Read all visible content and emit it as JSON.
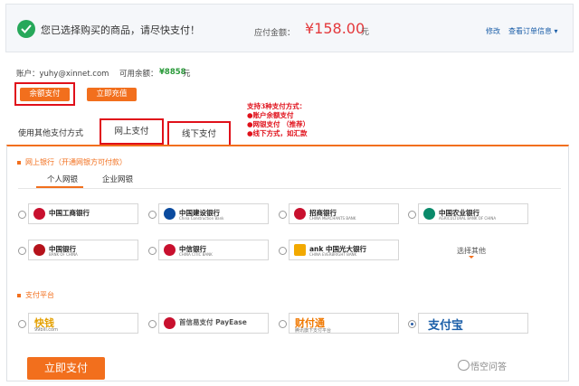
{
  "header": {
    "message": "您已选择购买的商品，请尽快支付！",
    "due_label": "应付金额：",
    "amount": "¥158.00",
    "amount_unit": "元",
    "modify_link": "修改",
    "order_info_link": "查看订单信息 ▾"
  },
  "account": {
    "account_text": "账户：yuhy@xinnet.com",
    "balance_label": "可用余额：",
    "balance_value": "¥8858",
    "balance_unit": "元",
    "balance_pay_button": "余额支付",
    "recharge_button": "立即充值"
  },
  "other_methods": {
    "label": "使用其他支付方式",
    "tab_online": "网上支付",
    "tab_offline": "线下支付"
  },
  "annotation": {
    "lines": [
      "支持3种支付方式：",
      "●账户余额支付",
      "●网银支付  （推荐）",
      "●线下方式，如汇款"
    ]
  },
  "online_bank": {
    "title": "网上银行（开通网银方可付款）",
    "tab_personal": "个人网银",
    "tab_corporate": "企业网银",
    "banks": [
      {
        "name": "中国工商银行",
        "sub": "",
        "color": "#c8102e"
      },
      {
        "name": "中国建设银行",
        "sub": "China Construction Bank",
        "color": "#0a4a9e"
      },
      {
        "name": "招商银行",
        "sub": "CHINA MERCHANTS BANK",
        "color": "#c8102e"
      },
      {
        "name": "中国农业银行",
        "sub": "AGRICULTURAL BANK OF CHINA",
        "color": "#0a8a6a"
      },
      {
        "name": "中国银行",
        "sub": "BANK OF CHINA",
        "color": "#b5121b"
      },
      {
        "name": "中信银行",
        "sub": "CHINA CITIC BANK",
        "color": "#c8102e"
      },
      {
        "name": "ank 中国光大银行",
        "sub": "CHINA EVERBRIGHT BANK",
        "color": "#f2a900"
      }
    ],
    "more_label": "选择其他"
  },
  "platform": {
    "title": "支付平台",
    "items": [
      {
        "name": "快钱",
        "sub": "99bill.com",
        "color": "#e4a000"
      },
      {
        "name": "首信易支付 PayEase",
        "sub": "",
        "color": "#c8102e"
      },
      {
        "name": "财付通",
        "sub": "腾讯旗下支付平台",
        "color": "#f07800"
      },
      {
        "name": "支付宝",
        "sub": "",
        "color": "#1a5ea8"
      }
    ]
  },
  "pay_button": "立即支付",
  "watermark": "悟空问答"
}
